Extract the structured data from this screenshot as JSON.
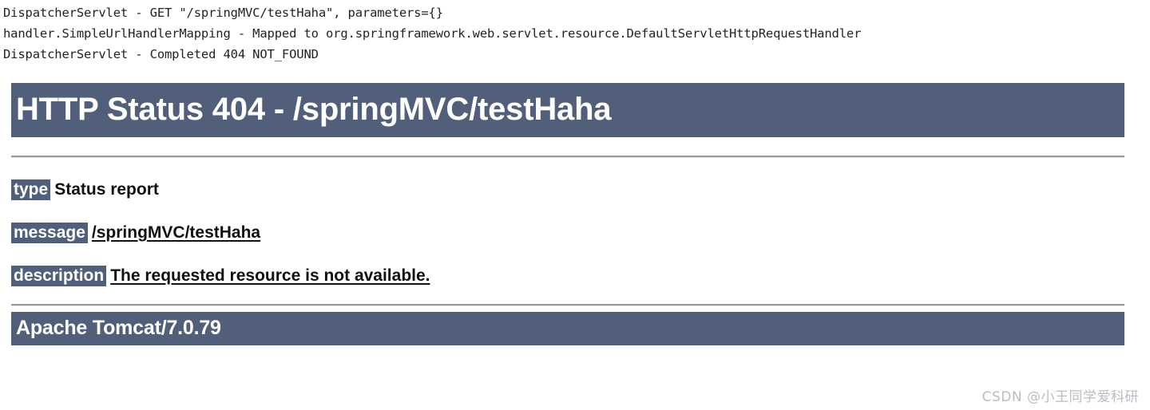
{
  "console": {
    "lines": [
      "DispatcherServlet - GET \"/springMVC/testHaha\", parameters={}",
      "handler.SimpleUrlHandlerMapping - Mapped to org.springframework.web.servlet.resource.DefaultServletHttpRequestHandler",
      "DispatcherServlet - Completed 404 NOT_FOUND"
    ]
  },
  "error_page": {
    "header_title": "HTTP Status 404 - /springMVC/testHaha",
    "details": [
      {
        "label": "type",
        "value": "Status report",
        "style": "plain"
      },
      {
        "label": "message",
        "value": "/springMVC/testHaha",
        "style": "linked"
      },
      {
        "label": "description",
        "value": "The requested resource is not available.",
        "style": "linked"
      }
    ],
    "footer_title": "Apache Tomcat/7.0.79"
  },
  "watermark": {
    "text": "CSDN @小王同学爱科研"
  },
  "colors": {
    "banner_background": "#525f7a",
    "banner_text": "#ffffff",
    "log_text": "#232323",
    "rule": "#9a9a9a",
    "watermark_text": "#b9bcc4"
  }
}
